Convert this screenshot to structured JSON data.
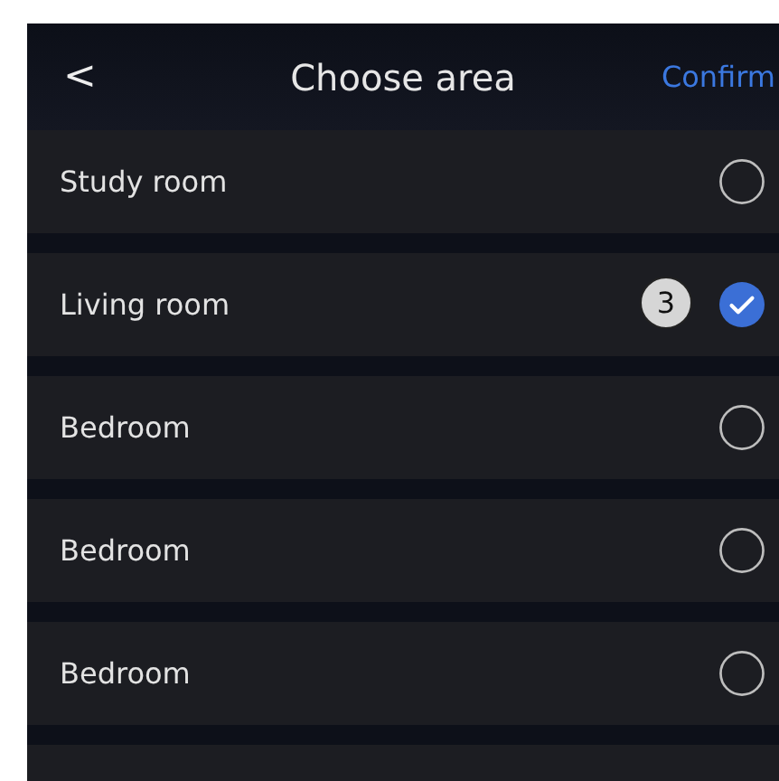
{
  "header": {
    "back": "<",
    "title": "Choose area",
    "action": "Confirm"
  },
  "areas": [
    {
      "name": "Study room",
      "selected": false
    },
    {
      "name": "Living room",
      "selected": true,
      "callout": "3"
    },
    {
      "name": "Bedroom",
      "selected": false
    },
    {
      "name": "Bedroom",
      "selected": false
    },
    {
      "name": "Bedroom",
      "selected": false
    }
  ]
}
